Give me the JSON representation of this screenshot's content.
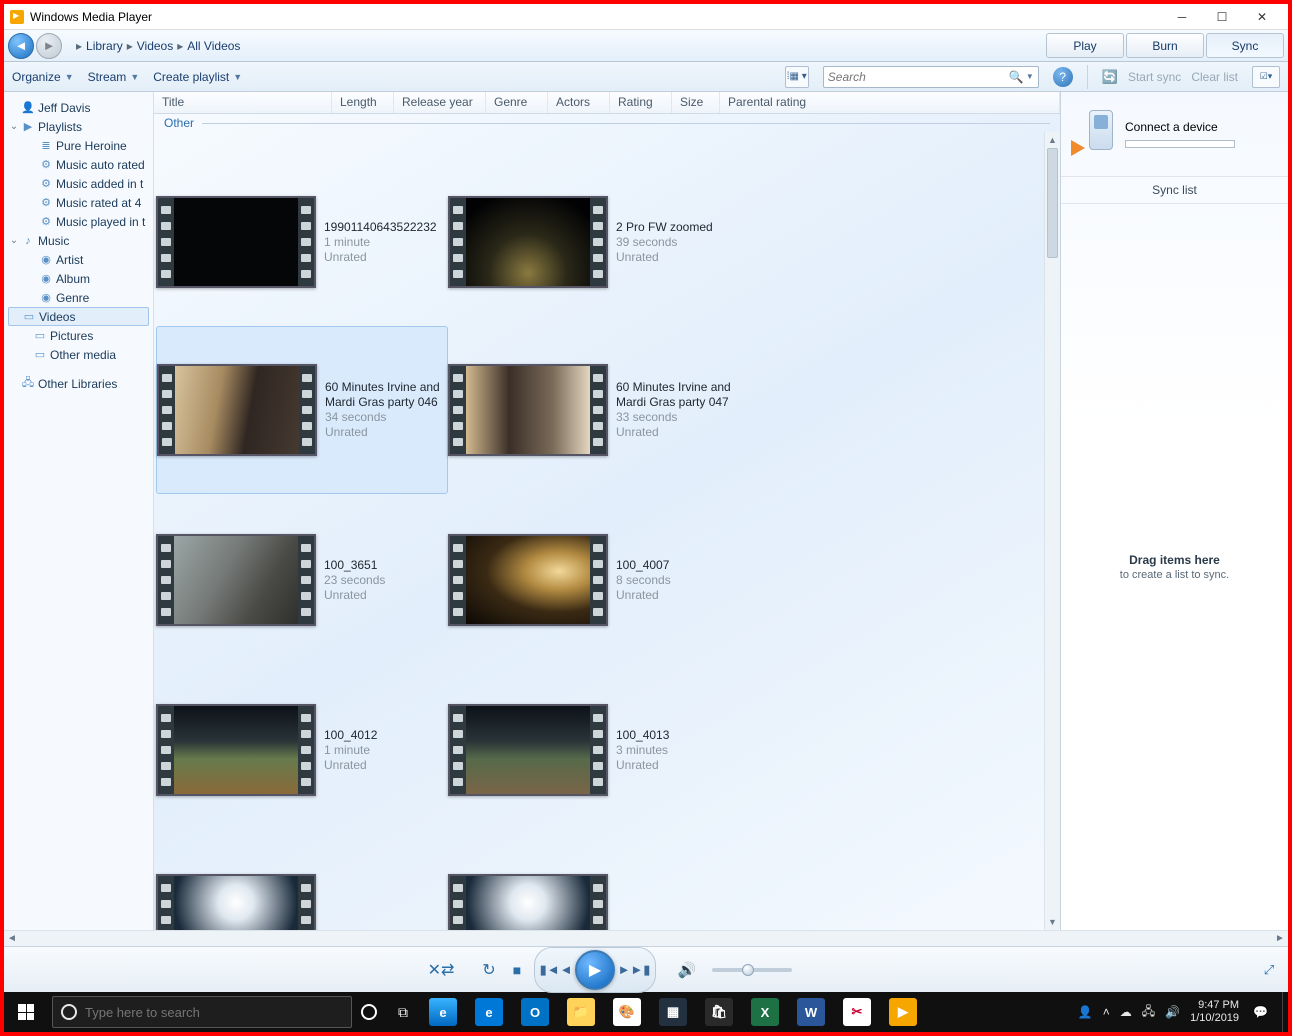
{
  "window": {
    "title": "Windows Media Player"
  },
  "breadcrumbs": [
    "Library",
    "Videos",
    "All Videos"
  ],
  "tabs": {
    "play": "Play",
    "burn": "Burn",
    "sync": "Sync"
  },
  "toolbar": {
    "organize": "Organize",
    "stream": "Stream",
    "create_playlist": "Create playlist",
    "search_placeholder": "Search"
  },
  "sync_toolbar": {
    "start_sync": "Start sync",
    "clear_list": "Clear list"
  },
  "columns": [
    "Title",
    "Length",
    "Release year",
    "Genre",
    "Actors",
    "Rating",
    "Size",
    "Parental rating"
  ],
  "group_label": "Other",
  "sidebar": {
    "user": "Jeff Davis",
    "playlists_label": "Playlists",
    "playlists": [
      "Pure Heroine",
      "Music auto rated",
      "Music added in t",
      "Music rated at 4",
      "Music played in t"
    ],
    "music_label": "Music",
    "music_children": [
      "Artist",
      "Album",
      "Genre"
    ],
    "videos": "Videos",
    "pictures": "Pictures",
    "other_media": "Other media",
    "other_libraries": "Other Libraries"
  },
  "videos": [
    {
      "title": "19901140643522232",
      "length": "1 minute",
      "rating": "Unrated",
      "thumb": "t-dark"
    },
    {
      "title": "2 Pro FW zoomed",
      "length": "39 seconds",
      "rating": "Unrated",
      "thumb": "t-lights"
    },
    {
      "title": "60 Minutes Irvine and Mardi Gras party 046",
      "length": "34 seconds",
      "rating": "Unrated",
      "thumb": "t-party1"
    },
    {
      "title": "60 Minutes Irvine and Mardi Gras party 047",
      "length": "33 seconds",
      "rating": "Unrated",
      "thumb": "t-party2"
    },
    {
      "title": "100_3651",
      "length": "23 seconds",
      "rating": "Unrated",
      "thumb": "t-wet"
    },
    {
      "title": "100_4007",
      "length": "8 seconds",
      "rating": "Unrated",
      "thumb": "t-sil"
    },
    {
      "title": "100_4012",
      "length": "1 minute",
      "rating": "Unrated",
      "thumb": "t-field1"
    },
    {
      "title": "100_4013",
      "length": "3 minutes",
      "rating": "Unrated",
      "thumb": "t-field2"
    },
    {
      "title": "",
      "length": "",
      "rating": "",
      "thumb": "t-glare"
    },
    {
      "title": "",
      "length": "",
      "rating": "",
      "thumb": "t-glare"
    }
  ],
  "selected_video_index": 2,
  "syncpanel": {
    "connect": "Connect a device",
    "list_label": "Sync list",
    "drop_main": "Drag items here",
    "drop_sub": "to create a list to sync."
  },
  "taskbar": {
    "search_placeholder": "Type here to search",
    "time": "9:47 PM",
    "date": "1/10/2019"
  }
}
